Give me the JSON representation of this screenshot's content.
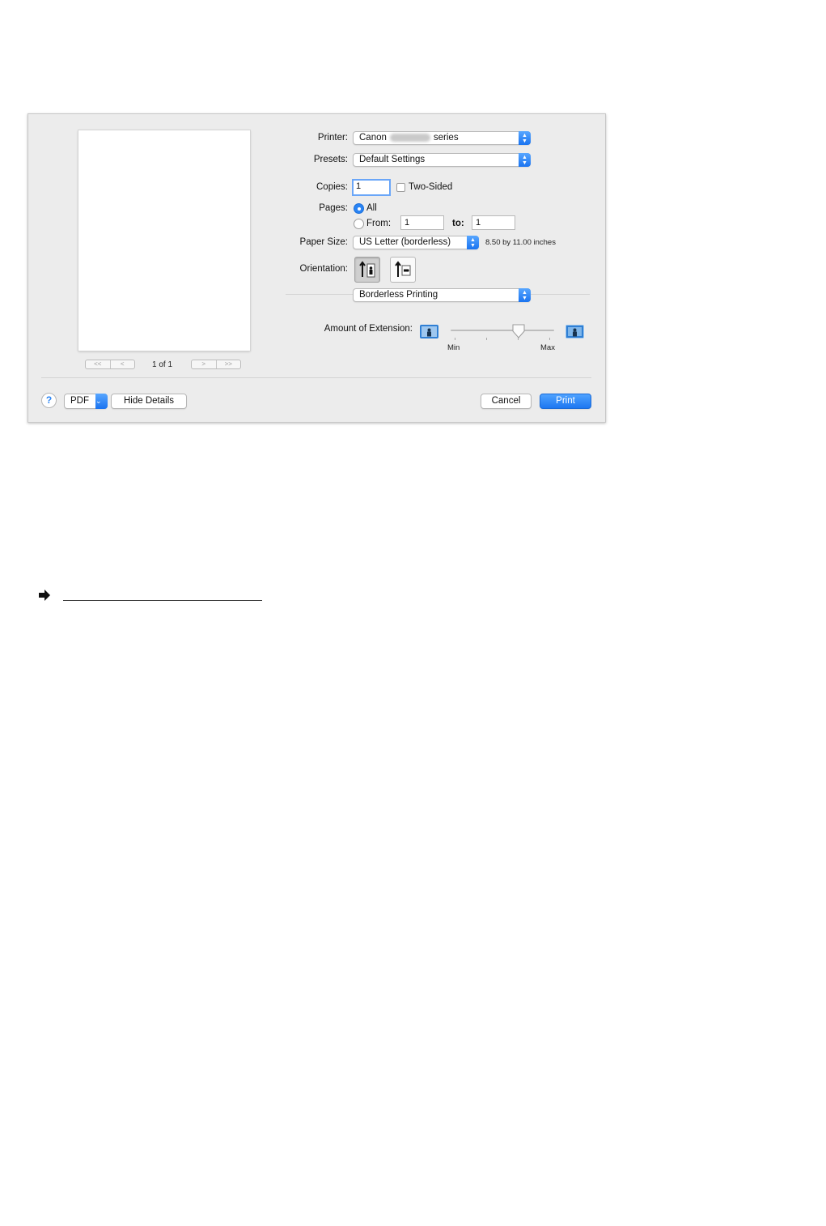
{
  "dialog": {
    "preview": {
      "nav_first": "<<",
      "nav_prev": "<",
      "page_count": "1 of 1",
      "nav_next": ">",
      "nav_last": ">>"
    },
    "printer": {
      "label": "Printer:",
      "name_prefix": "Canon",
      "name_suffix": "series"
    },
    "presets": {
      "label": "Presets:",
      "value": "Default Settings"
    },
    "copies": {
      "label": "Copies:",
      "value": "1",
      "two_sided_label": "Two-Sided",
      "two_sided_checked": false
    },
    "pages": {
      "label": "Pages:",
      "all_label": "All",
      "from_label": "From:",
      "from_value": "1",
      "to_label": "to:",
      "to_value": "1",
      "selected": "all"
    },
    "paper_size": {
      "label": "Paper Size:",
      "value": "US Letter (borderless)",
      "dimensions": "8.50 by 11.00 inches"
    },
    "orientation": {
      "label": "Orientation:",
      "selected": "portrait"
    },
    "panel_select": {
      "value": "Borderless Printing"
    },
    "extension": {
      "label": "Amount of Extension:",
      "min_label": "Min",
      "max_label": "Max",
      "level": 0.66
    },
    "footer": {
      "help": "?",
      "pdf_label": "PDF",
      "hide_details_label": "Hide Details",
      "cancel_label": "Cancel",
      "print_label": "Print"
    }
  },
  "colors": {
    "accent": "#2a84f4",
    "dialog_bg": "#ececec"
  }
}
